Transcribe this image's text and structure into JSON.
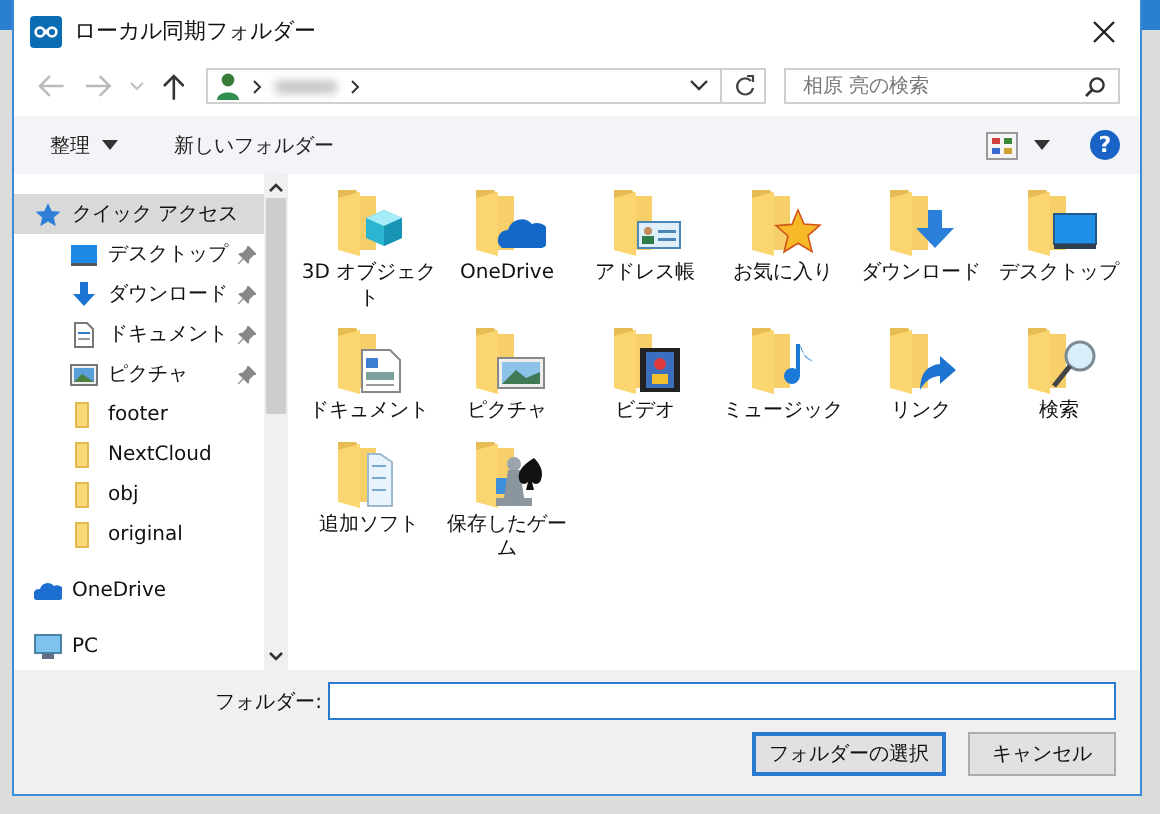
{
  "window": {
    "title": "ローカル同期フォルダー"
  },
  "navigation": {
    "back_disabled": true,
    "forward_disabled": true
  },
  "search": {
    "placeholder": "相原 亮の検索"
  },
  "toolbar": {
    "organize": "整理",
    "new_folder": "新しいフォルダー",
    "help": "?"
  },
  "sidebar": {
    "items": [
      {
        "label": "クイック アクセス",
        "kind": "star",
        "selected": true,
        "children": [
          {
            "label": "デスクトップ",
            "kind": "desktop",
            "pinned": true,
            "selected": false
          },
          {
            "label": "ダウンロード",
            "kind": "download",
            "pinned": true,
            "selected": false
          },
          {
            "label": "ドキュメント",
            "kind": "document",
            "pinned": true,
            "selected": false
          },
          {
            "label": "ピクチャ",
            "kind": "picture",
            "pinned": true,
            "selected": false
          },
          {
            "label": "footer",
            "kind": "folder",
            "pinned": false,
            "selected": false
          },
          {
            "label": "NextCloud",
            "kind": "folder",
            "pinned": false,
            "selected": false
          },
          {
            "label": "obj",
            "kind": "folder",
            "pinned": false,
            "selected": false
          },
          {
            "label": "original",
            "kind": "folder",
            "pinned": false,
            "selected": false
          }
        ]
      },
      {
        "label": "OneDrive",
        "kind": "cloud",
        "selected": false
      },
      {
        "label": "PC",
        "kind": "pc",
        "selected": false
      }
    ]
  },
  "items": [
    {
      "label": "3D オブジェクト",
      "kind": "cube"
    },
    {
      "label": "OneDrive",
      "kind": "cloud"
    },
    {
      "label": "アドレス帳",
      "kind": "contact"
    },
    {
      "label": "お気に入り",
      "kind": "star"
    },
    {
      "label": "ダウンロード",
      "kind": "download"
    },
    {
      "label": "デスクトップ",
      "kind": "desktop"
    },
    {
      "label": "ドキュメント",
      "kind": "document"
    },
    {
      "label": "ピクチャ",
      "kind": "picture"
    },
    {
      "label": "ビデオ",
      "kind": "video"
    },
    {
      "label": "ミュージック",
      "kind": "music"
    },
    {
      "label": "リンク",
      "kind": "link"
    },
    {
      "label": "検索",
      "kind": "search"
    },
    {
      "label": "追加ソフト",
      "kind": "software"
    },
    {
      "label": "保存したゲーム",
      "kind": "game"
    }
  ],
  "folder_field": {
    "label": "フォルダー:"
  },
  "buttons": [
    {
      "label": "フォルダーの選択",
      "kind": "primary"
    },
    {
      "label": "キャンセル",
      "kind": "secondary"
    }
  ]
}
